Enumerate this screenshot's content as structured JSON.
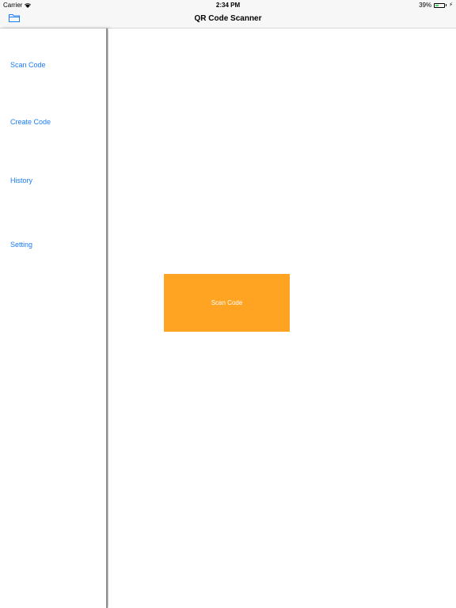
{
  "status_bar": {
    "carrier": "Carrier",
    "time": "2:34 PM",
    "battery_percent": "39%",
    "battery_level": 0.39,
    "charging": true
  },
  "nav_bar": {
    "title": "QR Code Scanner",
    "left_icon": "folder-icon"
  },
  "sidebar": {
    "items": [
      {
        "label": "Scan Code"
      },
      {
        "label": "Create Code"
      },
      {
        "label": "History"
      },
      {
        "label": "Setting"
      }
    ]
  },
  "main": {
    "scan_button_label": "Scan Code"
  },
  "colors": {
    "accent_blue": "#1a7cf5",
    "scan_button_orange": "#ffa322",
    "battery_green": "#4cd964"
  }
}
